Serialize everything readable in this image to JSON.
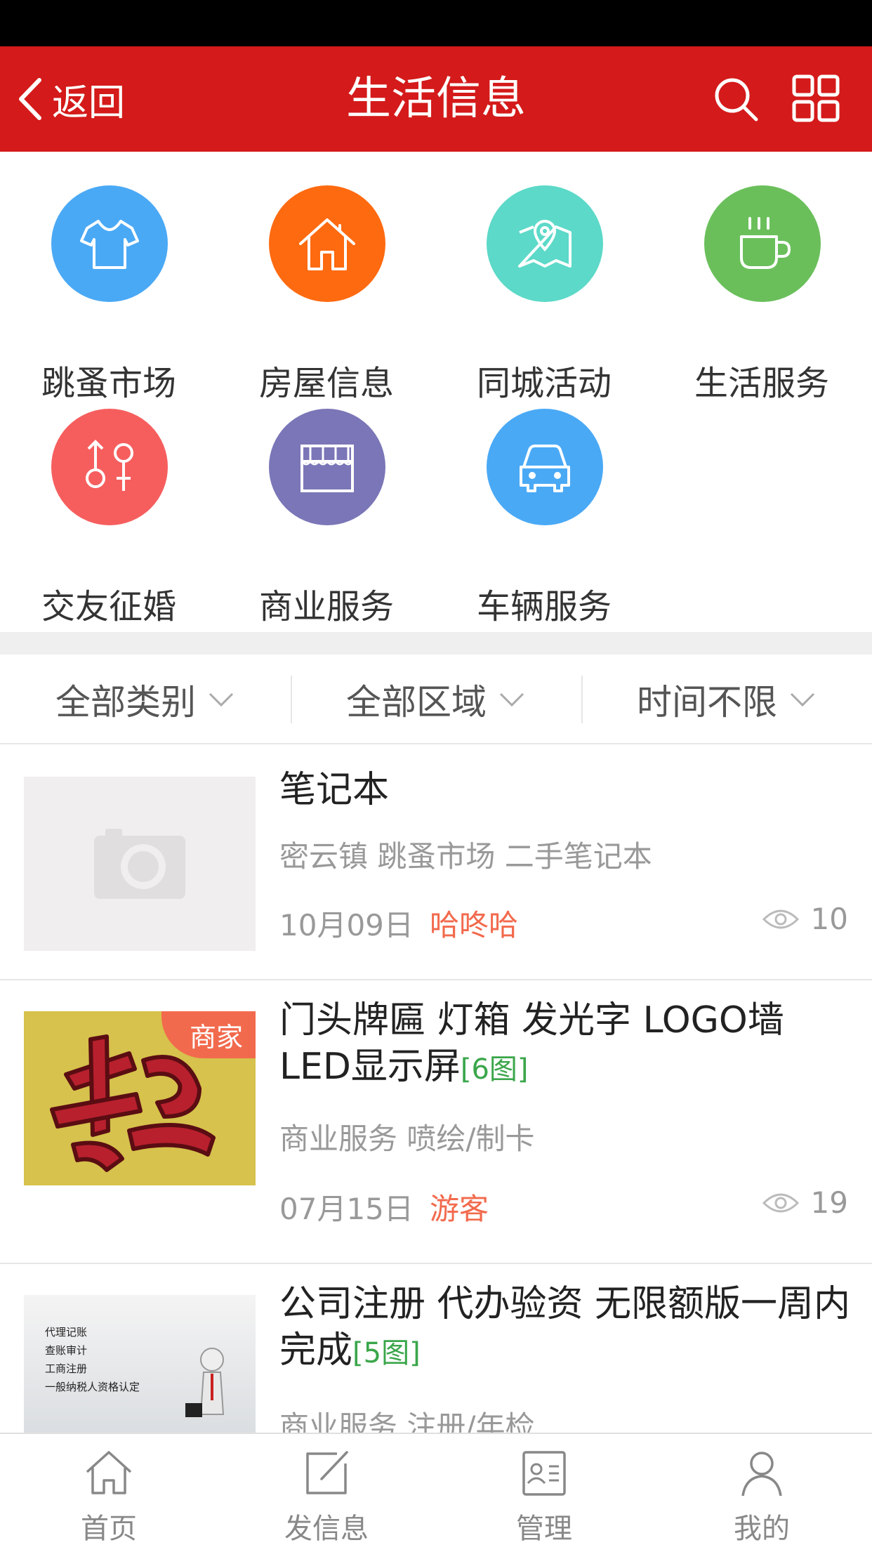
{
  "header": {
    "back_label": "返回",
    "title": "生活信息"
  },
  "categories": [
    {
      "label": "跳蚤市场",
      "icon": "tshirt-icon",
      "color": "#4aa9f5"
    },
    {
      "label": "房屋信息",
      "icon": "house-icon",
      "color": "#fe6a10"
    },
    {
      "label": "同城活动",
      "icon": "map-icon",
      "color": "#5cd9c8"
    },
    {
      "label": "生活服务",
      "icon": "coffee-cup-icon",
      "color": "#6abf5b"
    },
    {
      "label": "交友征婚",
      "icon": "gender-icon",
      "color": "#f65e5e"
    },
    {
      "label": "商业服务",
      "icon": "storefront-icon",
      "color": "#7a76b7"
    },
    {
      "label": "车辆服务",
      "icon": "car-icon",
      "color": "#4aa9f5"
    }
  ],
  "filters": [
    {
      "label": "全部类别"
    },
    {
      "label": "全部区域"
    },
    {
      "label": "时间不限"
    }
  ],
  "listings": [
    {
      "title": "笔记本",
      "pic_count": "",
      "subtitle": "密云镇 跳蚤市场 二手笔记本",
      "date": "10月09日",
      "user": "哈咚哈",
      "views": "10",
      "badge": ""
    },
    {
      "title": "门头牌匾 灯箱 发光字 LOGO墙 LED显示屏",
      "pic_count": "[6图]",
      "subtitle": "商业服务 喷绘/制卡",
      "date": "07月15日",
      "user": "游客",
      "views": "19",
      "badge": "商家"
    },
    {
      "title": "公司注册 代办验资 无限额版一周内完成",
      "pic_count": "[5图]",
      "subtitle": "商业服务 注册/年检",
      "date": "",
      "user": "",
      "views": "",
      "badge": "",
      "thumb_lines": [
        "代理记账",
        "查账审计",
        "工商注册",
        "一般纳税人资格认定"
      ]
    }
  ],
  "tabbar": [
    {
      "label": "首页",
      "icon": "home-icon"
    },
    {
      "label": "发信息",
      "icon": "compose-icon"
    },
    {
      "label": "管理",
      "icon": "id-card-icon"
    },
    {
      "label": "我的",
      "icon": "user-icon"
    }
  ],
  "colors": {
    "brand_red": "#d41a1a",
    "accent_orange": "#f26a4d",
    "pic_count_green": "#3aa64a"
  }
}
